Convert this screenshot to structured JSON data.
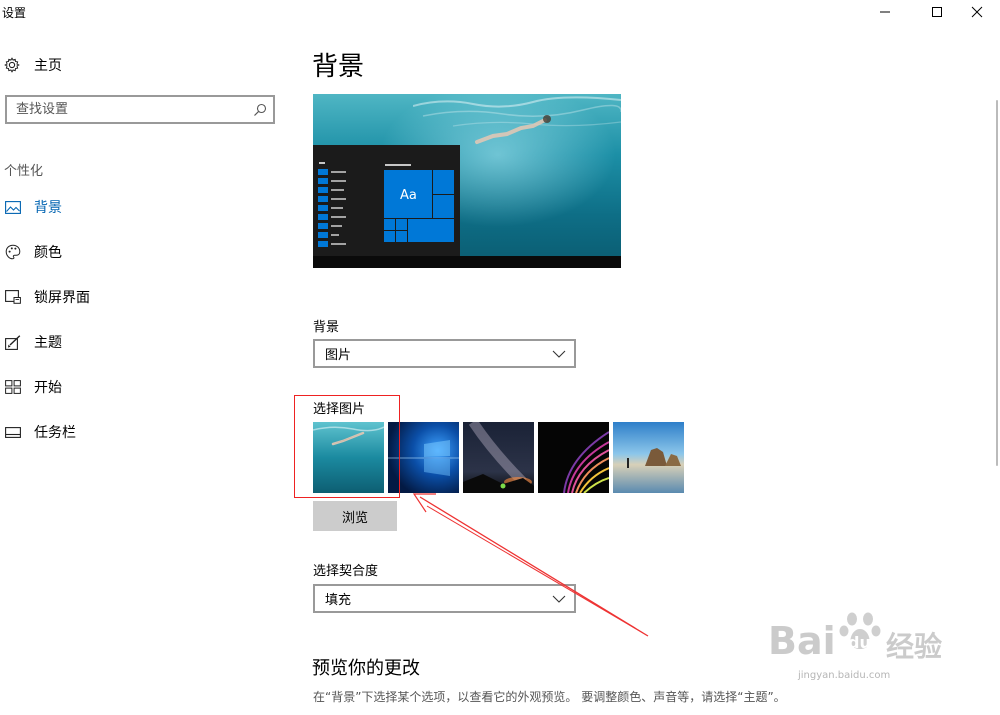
{
  "window": {
    "title": "设置",
    "controls": [
      "minimize-icon",
      "maximize-icon",
      "close-icon"
    ]
  },
  "sidebar": {
    "home_label": "主页",
    "search_placeholder": "查找设置",
    "section_label": "个性化",
    "items": [
      {
        "label": "背景",
        "icon": "picture-icon",
        "active": true
      },
      {
        "label": "颜色",
        "icon": "palette-icon",
        "active": false
      },
      {
        "label": "锁屏界面",
        "icon": "lock-screen-icon",
        "active": false
      },
      {
        "label": "主题",
        "icon": "theme-brush-icon",
        "active": false
      },
      {
        "label": "开始",
        "icon": "start-grid-icon",
        "active": false
      },
      {
        "label": "任务栏",
        "icon": "taskbar-icon",
        "active": false
      }
    ],
    "accent_color": "#0063B1"
  },
  "main": {
    "title": "背景",
    "preview_tile_text": "Aa",
    "background_label": "背景",
    "background_value": "图片",
    "choose_picture_label": "选择图片",
    "browse_label": "浏览",
    "fit_label": "选择契合度",
    "fit_value": "填充",
    "preview_heading": "预览你的更改",
    "preview_desc": "在“背景”下选择某个选项，以查看它的外观预览。 要调整颜色、声音等，请选择“主题”。"
  },
  "watermark": {
    "brand": "Bai",
    "brand2": "du",
    "brand_cn": "经验",
    "url": "jingyan.baidu.com"
  }
}
